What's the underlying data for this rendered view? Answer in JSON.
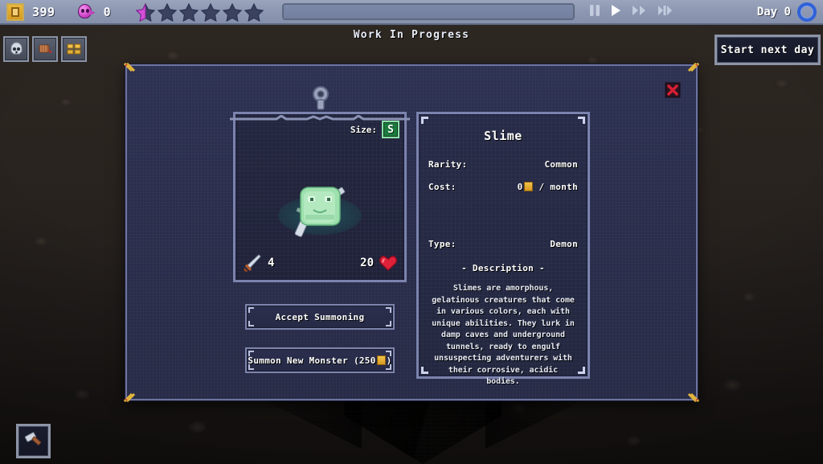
{
  "hud": {
    "gold_icon": "gold-coin-icon",
    "gold_value": "399",
    "soul_icon": "soul-ghost-icon",
    "soul_value": "0",
    "stars_total": 6,
    "stars_filled": 1,
    "transport": [
      {
        "name": "pause-button",
        "glyph": "pause"
      },
      {
        "name": "play-button",
        "glyph": "play"
      },
      {
        "name": "fast-forward-button",
        "glyph": "ffwd"
      },
      {
        "name": "ultra-fast-forward-button",
        "glyph": "ffwd2"
      }
    ],
    "day_label": "Day 0",
    "day_ring_color": "#2f62d8"
  },
  "wip_banner": "Work In Progress",
  "resource_slots": [
    {
      "name": "skull-icon",
      "glyph": "☠"
    },
    {
      "name": "meat-icon",
      "glyph": "🍖"
    },
    {
      "name": "gold-bars-icon",
      "glyph": "░"
    }
  ],
  "tool_button": {
    "name": "hammer-icon"
  },
  "start_next_day_label": "Start next day",
  "dialog": {
    "close_label": "✕",
    "monster_panel": {
      "size_label": "Size:",
      "size_value": "S",
      "attack_icon": "sword-icon",
      "attack_value": "4",
      "health_value": "20",
      "health_icon": "heart-icon",
      "creature": "slime-sprite"
    },
    "buttons": {
      "accept": "Accept Summoning",
      "summon_prefix": "Summon New Monster (250",
      "summon_suffix": ")"
    },
    "info": {
      "name": "Slime",
      "rarity_label": "Rarity:",
      "rarity_value": "Common",
      "cost_label": "Cost:",
      "cost_value": "0",
      "cost_suffix": "/ month",
      "type_label": "Type:",
      "type_value": "Demon",
      "description_header": "- Description -",
      "description": "Slimes are amorphous, gelatinous creatures that come in various colors, each with unique abilities. They lurk in damp caves and underground tunnels, ready to engulf unsuspecting adventurers with their corrosive, acidic bodies."
    }
  },
  "colors": {
    "hud_bar": "#8e98b2",
    "dialog_bg": "#2a2e4c",
    "panel_border": "#7b83ae",
    "corner_gold": "#e0b43c",
    "close_red": "#c81e32",
    "size_badge_green": "#1d7a3e",
    "slime_green": "#8fd9a0"
  }
}
